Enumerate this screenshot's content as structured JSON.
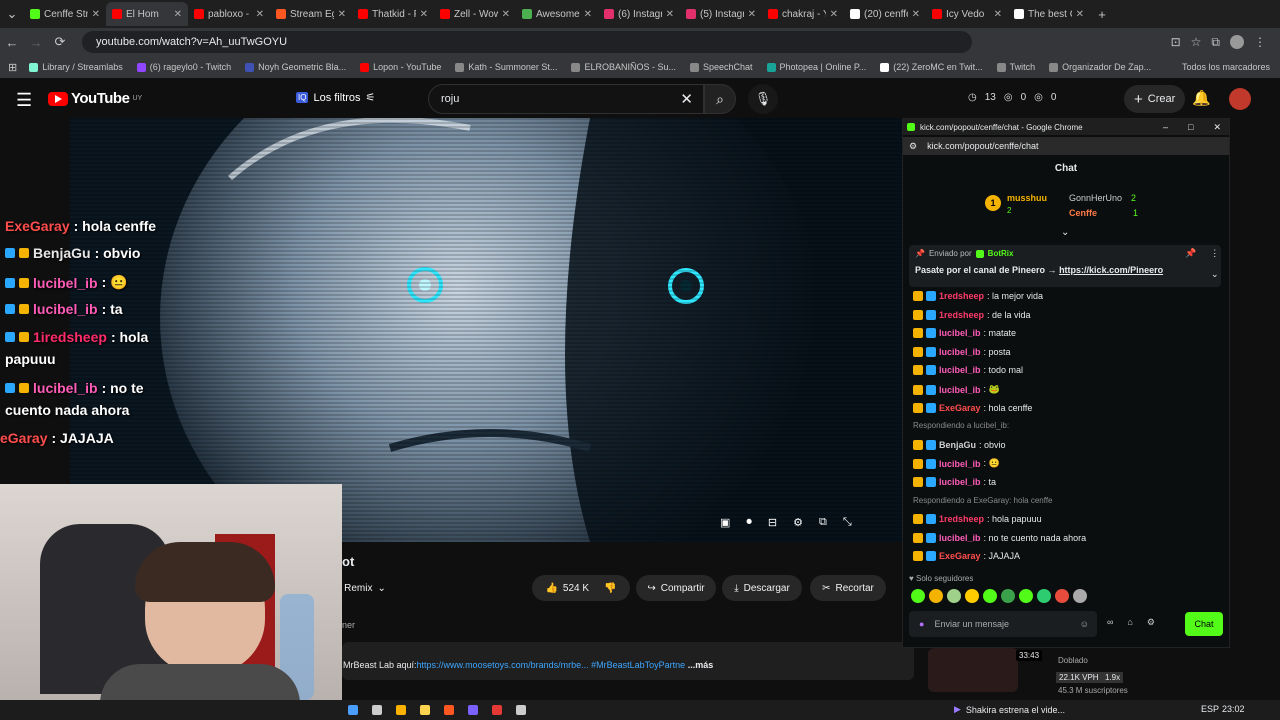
{
  "browser": {
    "tabs": [
      {
        "label": "Cenffe Str",
        "color": "#53fc18"
      },
      {
        "label": "El Hom",
        "color": "#ff0000"
      },
      {
        "label": "pabloxo -",
        "color": "#ff0000"
      },
      {
        "label": "Stream Eg",
        "color": "#ff5722"
      },
      {
        "label": "Thatkid - F",
        "color": "#ff0000"
      },
      {
        "label": "Zell - Wow",
        "color": "#ff0000"
      },
      {
        "label": "Awesome",
        "color": "#4caf50"
      },
      {
        "label": "(6) Instagr",
        "color": "#e1306c"
      },
      {
        "label": "(5) Instagr",
        "color": "#e1306c"
      },
      {
        "label": "chakraj - Y",
        "color": "#ff0000"
      },
      {
        "label": "(20) cenffe",
        "color": "#ffffff"
      },
      {
        "label": "Icy Vedo",
        "color": "#ff0000"
      },
      {
        "label": "The best C",
        "color": "#ffffff"
      }
    ],
    "url": "youtube.com/watch?v=Ah_uuTwGOYU",
    "bookmarks": [
      {
        "label": "Library / Streamlabs",
        "color": "#80f5d2"
      },
      {
        "label": "(6) rageylo0 - Twitch",
        "color": "#9146ff"
      },
      {
        "label": "Noyh Geometric Bla...",
        "color": "#3f51b5"
      },
      {
        "label": "Lopon - YouTube",
        "color": "#ff0000"
      },
      {
        "label": "Kath - Summoner St...",
        "color": "#888888"
      },
      {
        "label": "ELROBANIÑOS - Su...",
        "color": "#888888"
      },
      {
        "label": "SpeechChat",
        "color": "#888888"
      },
      {
        "label": "Photopea | Online P...",
        "color": "#18a497"
      },
      {
        "label": "(22) ZeroMC en Twit...",
        "color": "#ffffff"
      },
      {
        "label": "Twitch",
        "color": "#888888"
      },
      {
        "label": "Organizador De Zap...",
        "color": "#888888"
      }
    ],
    "all_bookmarks": "Todos los marcadores"
  },
  "youtube": {
    "logo": "YouTube",
    "region": "UY",
    "filters": "Los filtros",
    "search_value": "roju",
    "counters": [
      "13",
      "0",
      "0"
    ],
    "create": "Crear"
  },
  "video": {
    "title_fragment": "ot",
    "remix": "Remix",
    "likes": "524 K",
    "share": "Compartir",
    "download": "Descargar",
    "clip": "Recortar",
    "channel_fragment": "ner",
    "desc_prefix": "MrBeast Lab aquí:",
    "desc_link": "https://www.moosetoys.com/brands/mrbe...",
    "desc_tag": "#MrBeastLabToyPartne",
    "desc_more": "...más"
  },
  "overlay_chat": [
    {
      "user": "ExeGaray",
      "msg": ": hola cenffe",
      "color": "#ff4d4d"
    },
    {
      "user": "BenjaGu",
      "msg": ": obvio",
      "color": "#e6e6e6"
    },
    {
      "user": "lucibel_ib",
      "msg": " : 😐",
      "color": "#ff5cb8"
    },
    {
      "user": "lucibel_ib",
      "msg": " : ta",
      "color": "#ff5cb8"
    },
    {
      "user": "1iredsheep",
      "msg": " : hola",
      "color": "#ff2b6a"
    },
    {
      "user": "",
      "msg": "papuuu",
      "color": "#ffffff"
    },
    {
      "user": "lucibel_ib",
      "msg": " : no te",
      "color": "#ff5cb8"
    },
    {
      "user": "",
      "msg": "cuento nada ahora",
      "color": "#ffffff"
    },
    {
      "user": "eGaray",
      "msg": " : JAJAJA",
      "color": "#ff4d4d"
    }
  ],
  "chat_window": {
    "title": "kick.com/popout/cenffe/chat - Google Chrome",
    "url": "kick.com/popout/cenffe/chat",
    "header": "Chat",
    "leader1": "musshuu",
    "leader1_count": "2",
    "leader2": "GonnHerUno",
    "leader2_count": "2",
    "leader3": "Cenffe",
    "leader3_count": "1",
    "pinned_by": "Enviado por",
    "pinned_user": "BotRix",
    "pinned_text": "Pasate por el canal de Pineero → ",
    "pinned_link": "https://kick.com/Pineero",
    "messages": [
      {
        "user": "1redsheep",
        "msg": ": la mejor vida",
        "color": "#ff3b6b"
      },
      {
        "user": "1redsheep",
        "msg": ": de la vida",
        "color": "#ff3b6b"
      },
      {
        "user": "lucibel_ib",
        "msg": ": matate",
        "color": "#ff5cb8"
      },
      {
        "user": "lucibel_ib",
        "msg": ": posta",
        "color": "#ff5cb8"
      },
      {
        "user": "lucibel_ib",
        "msg": ": todo mal",
        "color": "#ff5cb8"
      },
      {
        "user": "lucibel_ib",
        "msg": ": 🐸",
        "color": "#ff5cb8"
      },
      {
        "user": "ExeGaray",
        "msg": ": hola cenffe",
        "color": "#ff4d4d"
      },
      {
        "user": "",
        "msg": "Respondiendo a lucibel_ib:",
        "color": "#8a8a8a"
      },
      {
        "user": "BenjaGu",
        "msg": ": obvio",
        "color": "#d0d0d0"
      },
      {
        "user": "lucibel_ib",
        "msg": ": 😐",
        "color": "#ff5cb8"
      },
      {
        "user": "lucibel_ib",
        "msg": ": ta",
        "color": "#ff5cb8"
      },
      {
        "user": "",
        "msg": "Respondiendo a ExeGaray: hola cenffe",
        "color": "#8a8a8a"
      },
      {
        "user": "1redsheep",
        "msg": ": hola papuuu",
        "color": "#ff3b6b"
      },
      {
        "user": "lucibel_ib",
        "msg": ": no te cuento nada ahora",
        "color": "#ff5cb8"
      },
      {
        "user": "ExeGaray",
        "msg": ": JAJAJA",
        "color": "#ff4d4d"
      }
    ],
    "followers_only": "Solo seguidores",
    "input_placeholder": "Enviar un mensaje",
    "send": "Chat"
  },
  "sidebar": {
    "views": "33:43",
    "dubbed": "Doblado",
    "vph": "22.1K VPH",
    "multiplier": "1.9x",
    "subs": "45.3 M suscriptores"
  },
  "taskbar": {
    "notif": "Shakira estrena el vide...",
    "lang": "ESP",
    "time": "23:02"
  },
  "colors": {
    "kick_green": "#53fc18",
    "yt_red": "#ff0000"
  }
}
